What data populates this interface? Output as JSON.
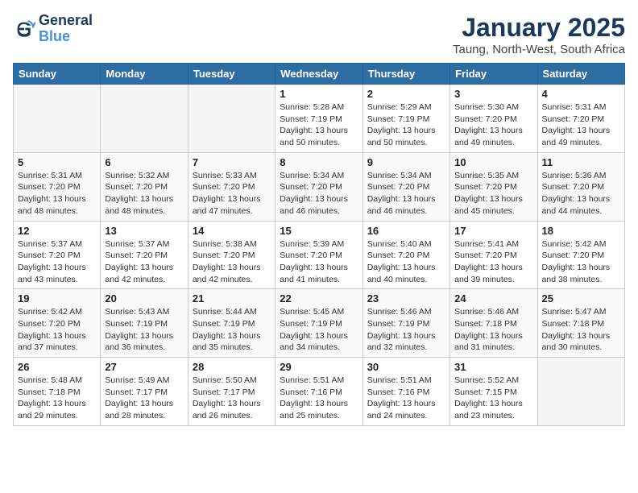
{
  "logo": {
    "line1": "General",
    "line2": "Blue"
  },
  "header": {
    "month": "January 2025",
    "location": "Taung, North-West, South Africa"
  },
  "weekdays": [
    "Sunday",
    "Monday",
    "Tuesday",
    "Wednesday",
    "Thursday",
    "Friday",
    "Saturday"
  ],
  "weeks": [
    [
      {
        "day": "",
        "info": ""
      },
      {
        "day": "",
        "info": ""
      },
      {
        "day": "",
        "info": ""
      },
      {
        "day": "1",
        "info": "Sunrise: 5:28 AM\nSunset: 7:19 PM\nDaylight: 13 hours\nand 50 minutes."
      },
      {
        "day": "2",
        "info": "Sunrise: 5:29 AM\nSunset: 7:19 PM\nDaylight: 13 hours\nand 50 minutes."
      },
      {
        "day": "3",
        "info": "Sunrise: 5:30 AM\nSunset: 7:20 PM\nDaylight: 13 hours\nand 49 minutes."
      },
      {
        "day": "4",
        "info": "Sunrise: 5:31 AM\nSunset: 7:20 PM\nDaylight: 13 hours\nand 49 minutes."
      }
    ],
    [
      {
        "day": "5",
        "info": "Sunrise: 5:31 AM\nSunset: 7:20 PM\nDaylight: 13 hours\nand 48 minutes."
      },
      {
        "day": "6",
        "info": "Sunrise: 5:32 AM\nSunset: 7:20 PM\nDaylight: 13 hours\nand 48 minutes."
      },
      {
        "day": "7",
        "info": "Sunrise: 5:33 AM\nSunset: 7:20 PM\nDaylight: 13 hours\nand 47 minutes."
      },
      {
        "day": "8",
        "info": "Sunrise: 5:34 AM\nSunset: 7:20 PM\nDaylight: 13 hours\nand 46 minutes."
      },
      {
        "day": "9",
        "info": "Sunrise: 5:34 AM\nSunset: 7:20 PM\nDaylight: 13 hours\nand 46 minutes."
      },
      {
        "day": "10",
        "info": "Sunrise: 5:35 AM\nSunset: 7:20 PM\nDaylight: 13 hours\nand 45 minutes."
      },
      {
        "day": "11",
        "info": "Sunrise: 5:36 AM\nSunset: 7:20 PM\nDaylight: 13 hours\nand 44 minutes."
      }
    ],
    [
      {
        "day": "12",
        "info": "Sunrise: 5:37 AM\nSunset: 7:20 PM\nDaylight: 13 hours\nand 43 minutes."
      },
      {
        "day": "13",
        "info": "Sunrise: 5:37 AM\nSunset: 7:20 PM\nDaylight: 13 hours\nand 42 minutes."
      },
      {
        "day": "14",
        "info": "Sunrise: 5:38 AM\nSunset: 7:20 PM\nDaylight: 13 hours\nand 42 minutes."
      },
      {
        "day": "15",
        "info": "Sunrise: 5:39 AM\nSunset: 7:20 PM\nDaylight: 13 hours\nand 41 minutes."
      },
      {
        "day": "16",
        "info": "Sunrise: 5:40 AM\nSunset: 7:20 PM\nDaylight: 13 hours\nand 40 minutes."
      },
      {
        "day": "17",
        "info": "Sunrise: 5:41 AM\nSunset: 7:20 PM\nDaylight: 13 hours\nand 39 minutes."
      },
      {
        "day": "18",
        "info": "Sunrise: 5:42 AM\nSunset: 7:20 PM\nDaylight: 13 hours\nand 38 minutes."
      }
    ],
    [
      {
        "day": "19",
        "info": "Sunrise: 5:42 AM\nSunset: 7:20 PM\nDaylight: 13 hours\nand 37 minutes."
      },
      {
        "day": "20",
        "info": "Sunrise: 5:43 AM\nSunset: 7:19 PM\nDaylight: 13 hours\nand 36 minutes."
      },
      {
        "day": "21",
        "info": "Sunrise: 5:44 AM\nSunset: 7:19 PM\nDaylight: 13 hours\nand 35 minutes."
      },
      {
        "day": "22",
        "info": "Sunrise: 5:45 AM\nSunset: 7:19 PM\nDaylight: 13 hours\nand 34 minutes."
      },
      {
        "day": "23",
        "info": "Sunrise: 5:46 AM\nSunset: 7:19 PM\nDaylight: 13 hours\nand 32 minutes."
      },
      {
        "day": "24",
        "info": "Sunrise: 5:46 AM\nSunset: 7:18 PM\nDaylight: 13 hours\nand 31 minutes."
      },
      {
        "day": "25",
        "info": "Sunrise: 5:47 AM\nSunset: 7:18 PM\nDaylight: 13 hours\nand 30 minutes."
      }
    ],
    [
      {
        "day": "26",
        "info": "Sunrise: 5:48 AM\nSunset: 7:18 PM\nDaylight: 13 hours\nand 29 minutes."
      },
      {
        "day": "27",
        "info": "Sunrise: 5:49 AM\nSunset: 7:17 PM\nDaylight: 13 hours\nand 28 minutes."
      },
      {
        "day": "28",
        "info": "Sunrise: 5:50 AM\nSunset: 7:17 PM\nDaylight: 13 hours\nand 26 minutes."
      },
      {
        "day": "29",
        "info": "Sunrise: 5:51 AM\nSunset: 7:16 PM\nDaylight: 13 hours\nand 25 minutes."
      },
      {
        "day": "30",
        "info": "Sunrise: 5:51 AM\nSunset: 7:16 PM\nDaylight: 13 hours\nand 24 minutes."
      },
      {
        "day": "31",
        "info": "Sunrise: 5:52 AM\nSunset: 7:15 PM\nDaylight: 13 hours\nand 23 minutes."
      },
      {
        "day": "",
        "info": ""
      }
    ]
  ]
}
